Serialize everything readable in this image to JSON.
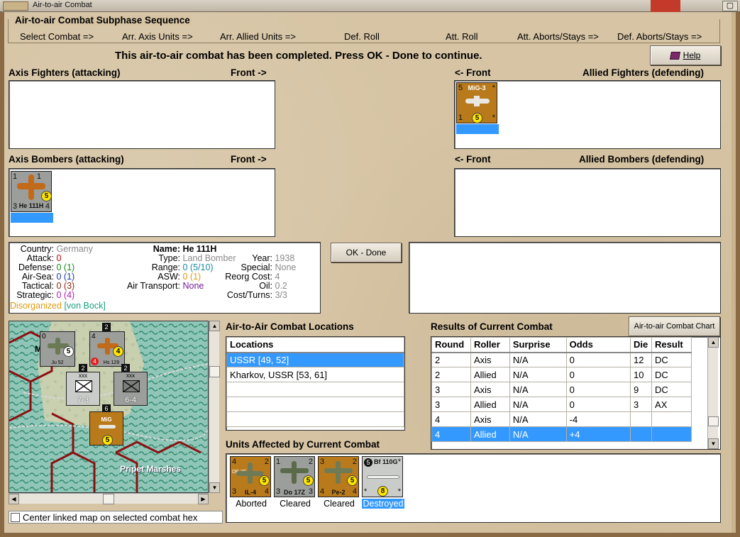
{
  "window": {
    "title": "Air-to-air Combat"
  },
  "sequence": {
    "heading": "Air-to-air Combat Subphase Sequence",
    "steps": [
      "Select Combat =>",
      "Arr. Axis Units =>",
      "Arr. Allied Units =>",
      "Def. Roll",
      "Att. Roll",
      "Att. Aborts/Stays =>",
      "Def. Aborts/Stays =>"
    ]
  },
  "status_message": "This air-to-air combat has been completed.  Press OK - Done to continue.",
  "help_label": "Help",
  "panels": {
    "axis_fighters": "Axis Fighters (attacking)",
    "axis_bombers": "Axis Bombers (attacking)",
    "front_right": "Front ->",
    "front_left": "<- Front",
    "allied_fighters": "Allied Fighters (defending)",
    "allied_bombers": "Allied Bombers (defending)"
  },
  "counters": {
    "mig3": {
      "name": "MiG-3",
      "tl": "5",
      "tr": "*",
      "bl": "1",
      "br": "*",
      "dot": "5"
    },
    "he111": {
      "name": "He 111H",
      "tl": "1",
      "tr": "1",
      "bl": "3",
      "br": "4",
      "dot": "5"
    }
  },
  "ok_label": "OK - Done",
  "unit_info": {
    "country_k": "Country:",
    "country_v": "Germany",
    "attack_k": "Attack:",
    "attack_v": "0",
    "defense_k": "Defense:",
    "defense_v": "0",
    "defense_p": "(1)",
    "airsea_k": "Air-Sea:",
    "airsea_v": "0",
    "airsea_p": "(1)",
    "tactical_k": "Tactical:",
    "tactical_v": "0",
    "tactical_p": "(3)",
    "strategic_k": "Strategic:",
    "strategic_v": "0",
    "strategic_p": "(4)",
    "status": "Disorganized",
    "leader": "[von Bock]",
    "name_k": "Name:",
    "name_v": "He 111H",
    "type_k": "Type:",
    "type_v": "Land Bomber",
    "year_k": "Year:",
    "year_v": "1938",
    "range_k": "Range:",
    "range_v": "0 (5/10)",
    "special_k": "Special:",
    "special_v": "None",
    "asw_k": "ASW:",
    "asw_v": "0 (1)",
    "reorg_k": "Reorg Cost:",
    "reorg_v": "4",
    "airtrans_k": "Air Transport:",
    "airtrans_v": "None",
    "oil_k": "Oil:",
    "oil_v": "0.2",
    "cost_k": "Cost/Turns:",
    "cost_v": "3/3"
  },
  "map": {
    "place_label": "Pripet Marshes",
    "stack_a": {
      "name": "Ju 52",
      "tl": "0",
      "dot": "5"
    },
    "stack_b": {
      "name": "Hs 129",
      "tl": "4",
      "dot": "4",
      "red": "4"
    },
    "corps_a": {
      "size": "xxx",
      "value": "7-3"
    },
    "corps_b": {
      "size": "xxx",
      "value": "6-4"
    },
    "mig": {
      "name": "MiG",
      "dot": "5"
    },
    "stack_nums": [
      "2",
      "2",
      "2",
      "6"
    ],
    "edge_letter": "M",
    "center_checkbox": "Center linked map on selected combat hex"
  },
  "locations": {
    "heading": "Air-to-Air Combat Locations",
    "col": "Locations",
    "rows": [
      "USSR [49, 52]",
      "Kharkov, USSR [53, 61]"
    ]
  },
  "results": {
    "heading": "Results of Current Combat",
    "chart_button": "Air-to-air Combat Chart",
    "cols": [
      "Round",
      "Roller",
      "Surprise",
      "Odds",
      "Die",
      "Result"
    ],
    "rows": [
      [
        "2",
        "Axis",
        "N/A",
        "0",
        "12",
        "DC"
      ],
      [
        "2",
        "Allied",
        "N/A",
        "0",
        "10",
        "DC"
      ],
      [
        "3",
        "Axis",
        "N/A",
        "0",
        "9",
        "DC"
      ],
      [
        "3",
        "Allied",
        "N/A",
        "0",
        "3",
        "AX"
      ],
      [
        "4",
        "Axis",
        "N/A",
        "-4",
        "",
        ""
      ],
      [
        "4",
        "Allied",
        "N/A",
        "+4",
        "",
        ""
      ]
    ]
  },
  "affected": {
    "heading": "Units Affected by Current Combat",
    "units": [
      {
        "name": "IL-4",
        "code": "DB-3F",
        "tl": "4",
        "tr": "2",
        "bl": "3",
        "br": "4",
        "dot": "5",
        "status": "Aborted"
      },
      {
        "name": "Do 17Z",
        "code": "",
        "tl": "1",
        "tr": "2",
        "bl": "3",
        "br": "3",
        "dot": "5",
        "status": "Cleared"
      },
      {
        "name": "Pe-2",
        "code": "",
        "tl": "3",
        "tr": "2",
        "bl": "4",
        "br": "4",
        "dot": "5",
        "status": "Cleared"
      },
      {
        "name": "Bf 110G",
        "code": "",
        "tl": "5",
        "tr": "*",
        "bl": "*",
        "br": "*",
        "dot": "8",
        "status": "Destroyed"
      }
    ]
  },
  "colors": {
    "selection": "#3399ff",
    "parchment": "#d6c4a4",
    "counter_brown": "#b97a1c"
  }
}
